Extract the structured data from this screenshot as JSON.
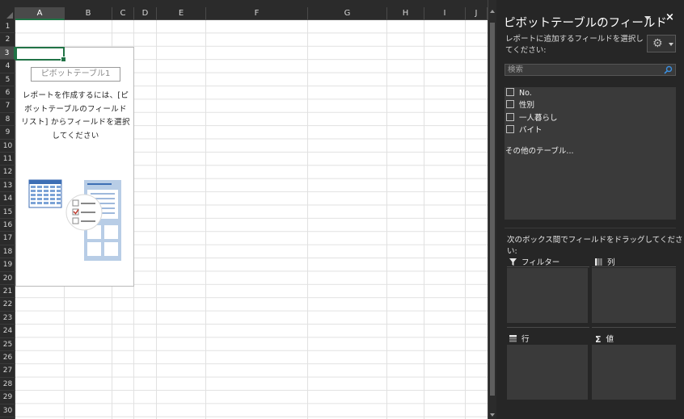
{
  "sheet": {
    "columns": [
      "A",
      "B",
      "C",
      "D",
      "E",
      "F",
      "G",
      "H",
      "I",
      "J"
    ],
    "selected_column": "A",
    "rows": [
      "1",
      "2",
      "3",
      "4",
      "5",
      "6",
      "7",
      "8",
      "9",
      "10",
      "11",
      "12",
      "13",
      "14",
      "15",
      "16",
      "17",
      "18",
      "19",
      "20",
      "21",
      "22",
      "23",
      "24",
      "25",
      "26",
      "27",
      "28",
      "29",
      "30"
    ],
    "selected_row": "3",
    "accent_color": "#217346"
  },
  "pivot_placeholder": {
    "name": "ピボットテーブル1",
    "message_lines": [
      "レポートを作成するには、[ピ",
      "ボットテーブルのフィールド",
      "リスト] からフィールドを選択",
      "してください"
    ]
  },
  "panel": {
    "title": "ピボットテーブルのフィールド",
    "close_label": "×",
    "subtitle": "レポートに追加するフィールドを選択してください:",
    "gear_icon": "gear-icon",
    "search_placeholder": "検索",
    "fields": [
      {
        "label": "No.",
        "checked": false
      },
      {
        "label": "性別",
        "checked": false
      },
      {
        "label": "一人暮らし",
        "checked": false
      },
      {
        "label": "バイト",
        "checked": false
      }
    ],
    "other_tables": "その他のテーブル...",
    "drag_hint": "次のボックス間でフィールドをドラッグしてください:",
    "areas": {
      "filter": {
        "label": "フィルター",
        "icon": "filter-icon"
      },
      "columns": {
        "label": "列",
        "icon": "columns-icon"
      },
      "rows": {
        "label": "行",
        "icon": "rows-icon"
      },
      "values": {
        "label": "値",
        "icon": "sigma-icon"
      }
    }
  }
}
